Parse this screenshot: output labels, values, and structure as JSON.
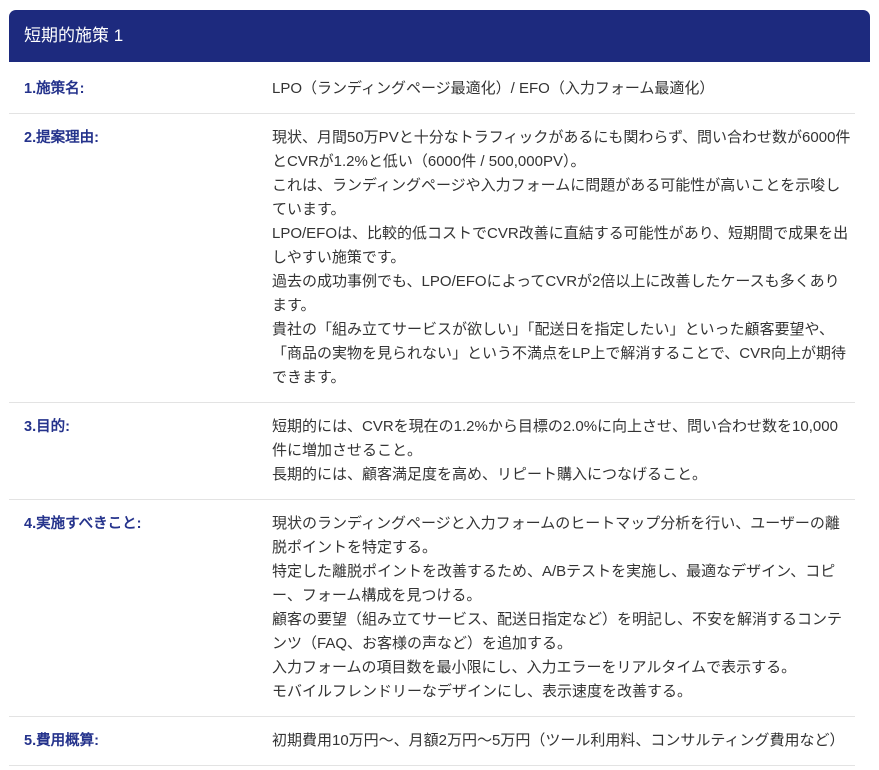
{
  "header": {
    "title": "短期的施策 1"
  },
  "colors": {
    "header_bg": "#1d2a7e",
    "header_text": "#ffffff",
    "label": "#25338c",
    "text": "#333333",
    "divider": "#e3e3e3"
  },
  "rows": [
    {
      "label": "1.施策名:",
      "paragraphs": [
        "LPO（ランディングページ最適化）/ EFO（入力フォーム最適化）"
      ]
    },
    {
      "label": "2.提案理由:",
      "paragraphs": [
        "現状、月間50万PVと十分なトラフィックがあるにも関わらず、問い合わせ数が6000件とCVRが1.2%と低い（6000件 / 500,000PV）。",
        "これは、ランディングページや入力フォームに問題がある可能性が高いことを示唆しています。",
        "LPO/EFOは、比較的低コストでCVR改善に直結する可能性があり、短期間で成果を出しやすい施策です。",
        "過去の成功事例でも、LPO/EFOによってCVRが2倍以上に改善したケースも多くあります。",
        "貴社の「組み立てサービスが欲しい」「配送日を指定したい」といった顧客要望や、「商品の実物を見られない」という不満点をLP上で解消することで、CVR向上が期待できます。"
      ]
    },
    {
      "label": "3.目的:",
      "paragraphs": [
        "短期的には、CVRを現在の1.2%から目標の2.0%に向上させ、問い合わせ数を10,000件に増加させること。",
        "長期的には、顧客満足度を高め、リピート購入につなげること。"
      ]
    },
    {
      "label": "4.実施すべきこと:",
      "paragraphs": [
        "現状のランディングページと入力フォームのヒートマップ分析を行い、ユーザーの離脱ポイントを特定する。",
        "特定した離脱ポイントを改善するため、A/Bテストを実施し、最適なデザイン、コピー、フォーム構成を見つける。",
        "顧客の要望（組み立てサービス、配送日指定など）を明記し、不安を解消するコンテンツ（FAQ、お客様の声など）を追加する。",
        "入力フォームの項目数を最小限にし、入力エラーをリアルタイムで表示する。",
        "モバイルフレンドリーなデザインにし、表示速度を改善する。"
      ]
    },
    {
      "label": "5.費用概算:",
      "paragraphs": [
        "初期費用10万円～、月額2万円～5万円（ツール利用料、コンサルティング費用など）"
      ]
    }
  ]
}
